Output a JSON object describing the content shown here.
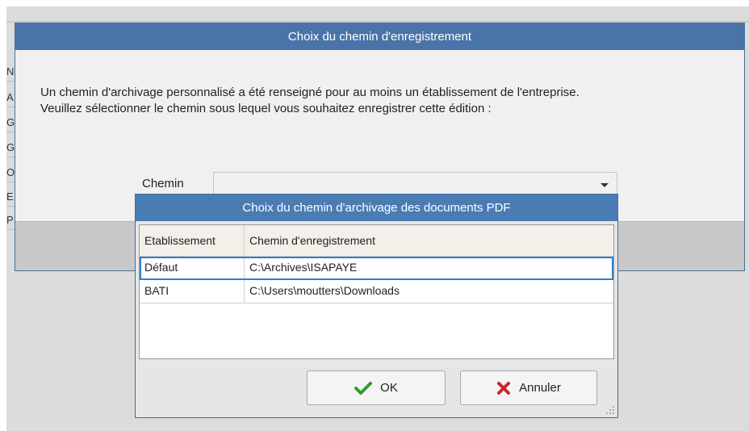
{
  "background_window": {
    "column_header": "N",
    "row_letters": [
      "A",
      "G",
      "G",
      "O",
      "E",
      "P"
    ]
  },
  "outer_dialog": {
    "title": "Choix du chemin d'enregistrement",
    "message_line1": "Un chemin d'archivage personnalisé a été renseigné pour au moins un établissement de l'entreprise.",
    "message_line2": "Veuillez sélectionner le chemin sous lequel vous souhaitez enregistrer cette édition :",
    "chemin_label": "Chemin",
    "chemin_value": ""
  },
  "inner_dialog": {
    "title": "Choix du chemin d'archivage des documents PDF",
    "columns": [
      "Etablissement",
      "Chemin d'enregistrement"
    ],
    "rows": [
      {
        "etablissement": "Défaut",
        "chemin": "C:\\Archives\\ISAPAYE"
      },
      {
        "etablissement": "BATI",
        "chemin": "C:\\Users\\moutters\\Downloads"
      }
    ],
    "ok_label": "OK",
    "cancel_label": "Annuler"
  },
  "colors": {
    "title_bar": "#4a74a8",
    "ok_check": "#2e9d2e",
    "cancel_cross": "#c8262b",
    "selection": "#2f7fd0"
  },
  "icons": [
    "chevron-down-icon",
    "check-icon",
    "cross-icon",
    "resize-grip-icon"
  ]
}
